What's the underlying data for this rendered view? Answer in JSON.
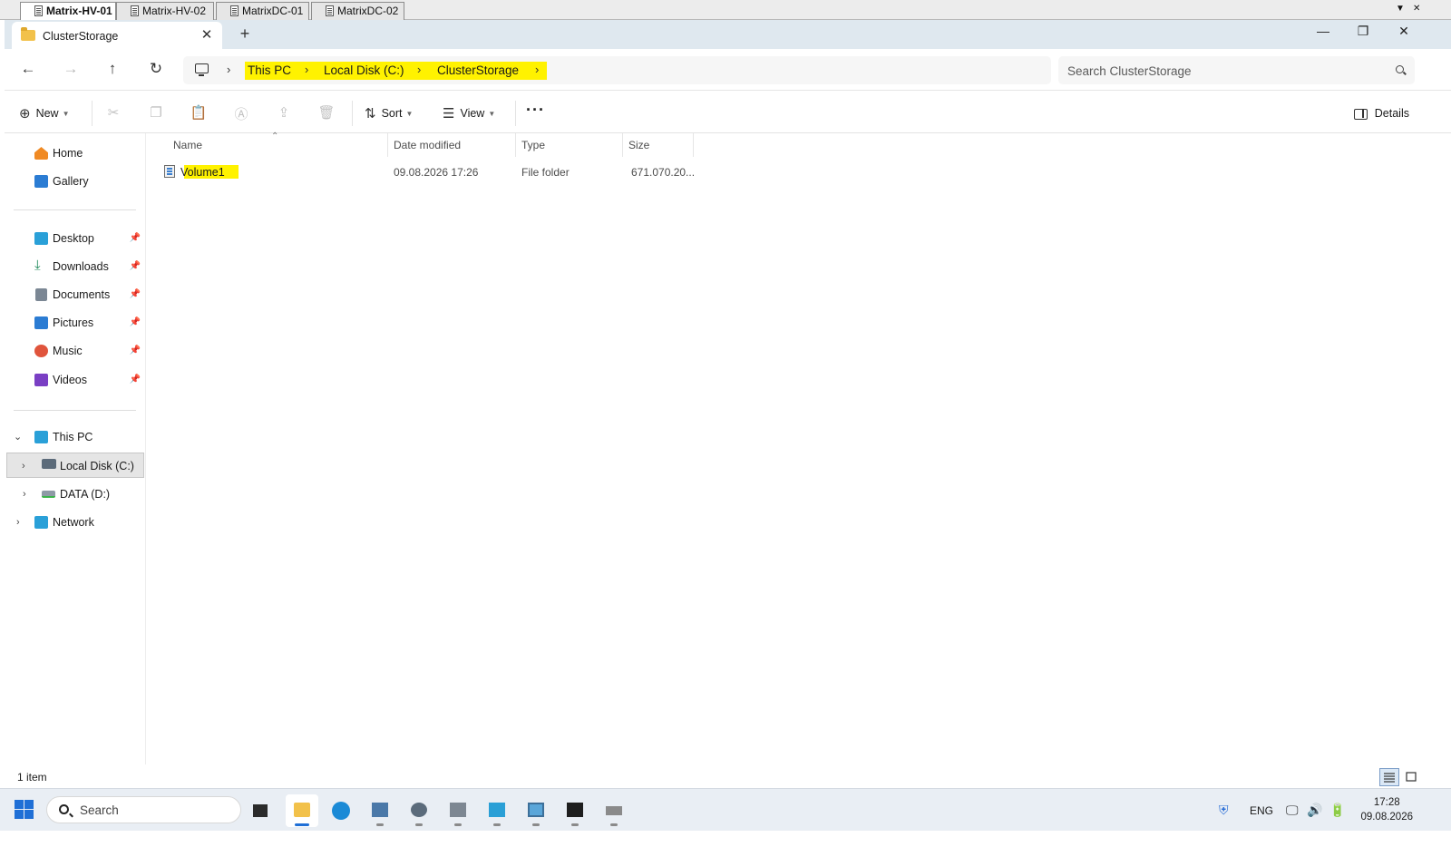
{
  "session_tabs": [
    {
      "label": "Matrix-HV-01",
      "active": true
    },
    {
      "label": "Matrix-HV-02",
      "active": false
    },
    {
      "label": "MatrixDC-01",
      "active": false
    },
    {
      "label": "MatrixDC-02",
      "active": false
    }
  ],
  "explorer": {
    "tab_title": "ClusterStorage",
    "new_tab_symbol": "+",
    "window_controls": {
      "minimize": "—",
      "maximize": "❐",
      "close": "✕"
    }
  },
  "address": {
    "breadcrumbs": [
      "This PC",
      "Local Disk (C:)",
      "ClusterStorage"
    ],
    "highlight_color": "#fff200"
  },
  "search": {
    "placeholder": "Search ClusterStorage"
  },
  "commandbar": {
    "new_label": "New",
    "sort_label": "Sort",
    "view_label": "View",
    "more_label": "···",
    "details_label": "Details",
    "disabled_actions": [
      "cut-icon",
      "copy-icon",
      "paste-icon",
      "rename-icon",
      "share-icon",
      "delete-icon"
    ]
  },
  "navpane": {
    "quick": [
      {
        "label": "Home",
        "icon": "home-icon"
      },
      {
        "label": "Gallery",
        "icon": "gallery-icon"
      }
    ],
    "pinned": [
      {
        "label": "Desktop",
        "icon": "desktop-icon"
      },
      {
        "label": "Downloads",
        "icon": "downloads-icon"
      },
      {
        "label": "Documents",
        "icon": "documents-icon"
      },
      {
        "label": "Pictures",
        "icon": "pictures-icon"
      },
      {
        "label": "Music",
        "icon": "music-icon"
      },
      {
        "label": "Videos",
        "icon": "videos-icon"
      }
    ],
    "tree": [
      {
        "label": "This PC",
        "icon": "this-pc-icon",
        "expanded": true
      },
      {
        "label": "Local Disk (C:)",
        "icon": "local-disk-icon",
        "selected": true
      },
      {
        "label": "DATA (D:)",
        "icon": "data-drive-icon"
      },
      {
        "label": "Network",
        "icon": "network-icon"
      }
    ]
  },
  "filelist": {
    "columns": [
      "Name",
      "Date modified",
      "Type",
      "Size"
    ],
    "rows": [
      {
        "name": "Volume1",
        "date_modified": "09.08.2026 17:26",
        "type": "File folder",
        "size": "671.070.20..."
      }
    ]
  },
  "status": {
    "item_count": "1 item"
  },
  "taskbar": {
    "search_label": "Search",
    "apps": [
      "task-view-icon",
      "file-explorer-icon",
      "edge-icon",
      "server-manager-icon",
      "settings-icon",
      "hyper-v-icon",
      "failover-cluster-icon",
      "remote-desktop-icon",
      "terminal-icon",
      "network-tool-icon"
    ],
    "language": "ENG",
    "time": "17:28",
    "date": "09.08.2026"
  }
}
